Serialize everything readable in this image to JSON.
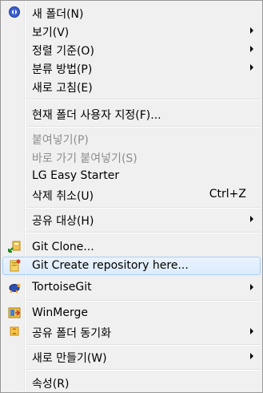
{
  "menu": {
    "items": [
      {
        "label": "새 폴더(N)",
        "icon": "new-folder-icon"
      },
      {
        "label": "보기(V)",
        "submenu": true
      },
      {
        "label": "정렬 기준(O)",
        "submenu": true
      },
      {
        "label": "분류 방법(P)",
        "submenu": true
      },
      {
        "label": "새로 고침(E)"
      },
      {
        "label": "현재 폴더 사용자 지정(F)..."
      },
      {
        "label": "붙여넣기(P)",
        "disabled": true
      },
      {
        "label": "바로 가기 붙여넣기(S)",
        "disabled": true
      },
      {
        "label": "LG Easy Starter"
      },
      {
        "label": "삭제 취소(U)",
        "shortcut": "Ctrl+Z"
      },
      {
        "label": "공유 대상(H)",
        "submenu": true
      },
      {
        "label": "Git Clone...",
        "icon": "git-clone-icon"
      },
      {
        "label": "Git Create repository here...",
        "icon": "git-create-repo-icon",
        "highlighted": true
      },
      {
        "label": "TortoiseGit",
        "icon": "tortoisegit-icon",
        "submenu": true
      },
      {
        "label": "WinMerge",
        "icon": "winmerge-icon"
      },
      {
        "label": "공유 폴더 동기화",
        "icon": "sync-folder-icon",
        "submenu": true
      },
      {
        "label": "새로 만들기(W)",
        "submenu": true
      },
      {
        "label": "속성(R)"
      }
    ]
  },
  "colors": {
    "highlight_border": "#a8d0f7",
    "disabled_text": "#8d8d8d",
    "menu_background": "#f0f0f0"
  }
}
